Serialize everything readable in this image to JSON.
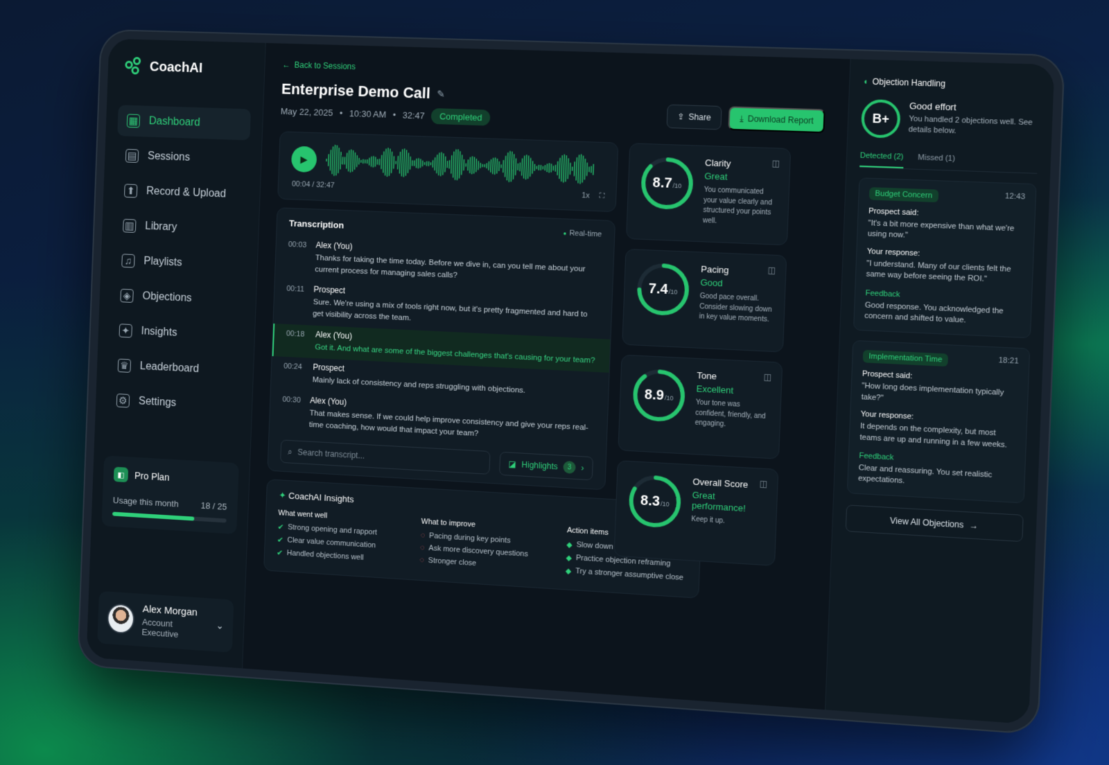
{
  "app": {
    "name": "CoachAI"
  },
  "sidebar": {
    "items": [
      {
        "label": "Dashboard",
        "icon": "dashboard-icon",
        "glyph": "▦",
        "active": true
      },
      {
        "label": "Sessions",
        "icon": "sessions-icon",
        "glyph": "▤"
      },
      {
        "label": "Record & Upload",
        "icon": "record-icon",
        "glyph": "⬆"
      },
      {
        "label": "Library",
        "icon": "library-icon",
        "glyph": "▥"
      },
      {
        "label": "Playlists",
        "icon": "playlists-icon",
        "glyph": "♫"
      },
      {
        "label": "Objections",
        "icon": "objections-icon",
        "glyph": "◈"
      },
      {
        "label": "Insights",
        "icon": "insights-icon",
        "glyph": "✦"
      },
      {
        "label": "Leaderboard",
        "icon": "leaderboard-icon",
        "glyph": "♛"
      },
      {
        "label": "Settings",
        "icon": "settings-icon",
        "glyph": "⚙"
      }
    ],
    "plan": {
      "name": "Pro Plan",
      "usage_label": "Usage this month",
      "usage_text": "18 / 25",
      "usage_fraction": 0.72
    },
    "user": {
      "name": "Alex Morgan",
      "role": "Account Executive"
    }
  },
  "header": {
    "back_label": "Back to Sessions",
    "title": "Enterprise Demo Call",
    "date": "May 22, 2025",
    "time": "10:30 AM",
    "duration": "32:47",
    "status": "Completed",
    "share_label": "Share",
    "download_label": "Download Report"
  },
  "audio": {
    "position": "00:04 / 32:47",
    "speed": "1x",
    "progress": 0.002
  },
  "transcript": {
    "title": "Transcription",
    "mode": "Real-time",
    "messages": [
      {
        "time": "00:03",
        "speaker": "Alex (You)",
        "text": "Thanks for taking the time today. Before we dive in, can you tell me about your current process for managing sales calls?"
      },
      {
        "time": "00:11",
        "speaker": "Prospect",
        "text": "Sure. We're using a mix of tools right now, but it's pretty fragmented and hard to get visibility across the team."
      },
      {
        "time": "00:18",
        "speaker": "Alex (You)",
        "text": "Got it. And what are some of the biggest challenges that's causing for your team?",
        "highlight": true
      },
      {
        "time": "00:24",
        "speaker": "Prospect",
        "text": "Mainly lack of consistency and reps struggling with objections."
      },
      {
        "time": "00:30",
        "speaker": "Alex (You)",
        "text": "That makes sense. If we could help improve consistency and give your reps real-time coaching, how would that impact your team?"
      }
    ],
    "search_placeholder": "Search transcript...",
    "highlights_label": "Highlights",
    "highlights_count": "3"
  },
  "scores": [
    {
      "name": "Clarity",
      "value": "8.7",
      "max": "/10",
      "fraction": 0.87,
      "grade": "Great",
      "desc": "You communicated your value clearly and structured your points well."
    },
    {
      "name": "Pacing",
      "value": "7.4",
      "max": "/10",
      "fraction": 0.74,
      "grade": "Good",
      "desc": "Good pace overall. Consider slowing down in key value moments."
    },
    {
      "name": "Tone",
      "value": "8.9",
      "max": "/10",
      "fraction": 0.89,
      "grade": "Excellent",
      "desc": "Your tone was confident, friendly, and engaging."
    },
    {
      "name": "Overall Score",
      "value": "8.3",
      "max": "/10",
      "fraction": 0.83,
      "grade": "Great performance!",
      "desc": "Keep it up."
    }
  ],
  "insights": {
    "title": "CoachAI Insights",
    "went_well": {
      "title": "What went well",
      "items": [
        "Strong opening and rapport",
        "Clear value communication",
        "Handled objections well"
      ]
    },
    "improve": {
      "title": "What to improve",
      "items": [
        "Pacing during key points",
        "Ask more discovery questions",
        "Stronger close"
      ]
    },
    "actions": {
      "title": "Action items",
      "items": [
        "Slow down in value statements",
        "Practice objection reframing",
        "Try a stronger assumptive close"
      ]
    }
  },
  "objections": {
    "title": "Objection Handling",
    "grade": "B+",
    "grade_title": "Good effort",
    "grade_text": "You handled 2 objections well. See details below.",
    "tab_detected": "Detected (2)",
    "tab_missed": "Missed (1)",
    "prospect_label": "Prospect said:",
    "response_label": "Your response:",
    "feedback_label": "Feedback",
    "items": [
      {
        "tag": "Budget Concern",
        "time": "12:43",
        "prospect": "\"It's a bit more expensive than what we're using now.\"",
        "response": "\"I understand. Many of our clients felt the same way before seeing the ROI.\"",
        "feedback": "Good response. You acknowledged the concern and shifted to value."
      },
      {
        "tag": "Implementation Time",
        "time": "18:21",
        "prospect": "\"How long does implementation typically take?\"",
        "response": "It depends on the complexity, but most teams are up and running in a few weeks.",
        "feedback": "Clear and reassuring. You set realistic expectations."
      }
    ],
    "view_all": "View All Objections"
  },
  "colors": {
    "accent": "#2fd07a",
    "background": "#0c141c",
    "card": "#111c25"
  }
}
